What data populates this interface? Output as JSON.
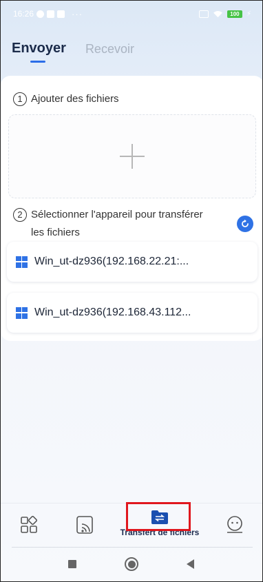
{
  "status_bar": {
    "time": "16:26",
    "battery": "100"
  },
  "tabs": [
    {
      "label": "Envoyer",
      "active": true
    },
    {
      "label": "Recevoir",
      "active": false
    }
  ],
  "steps": {
    "add_number": "1",
    "add_label": "Ajouter des fichiers",
    "select_number": "2",
    "select_label": "Sélectionner l'appareil pour transférer les fichiers"
  },
  "devices": [
    {
      "name": "Win_ut-dz936(192.168.22.21:...",
      "icon": "windows-icon"
    },
    {
      "name": "Win_ut-dz936(192.168.43.112...",
      "icon": "windows-icon"
    }
  ],
  "bottom_nav": {
    "apps_icon": "apps-grid-icon",
    "cast_icon": "screen-cast-icon",
    "transfer_label": "Transfert de fichiers",
    "transfer_icon": "folder-transfer-icon",
    "profile_icon": "profile-face-icon"
  },
  "colors": {
    "accent": "#2f72e5",
    "highlight": "#e0171e",
    "active_text": "#1b2b4a",
    "inactive_text": "#aab4c2"
  }
}
